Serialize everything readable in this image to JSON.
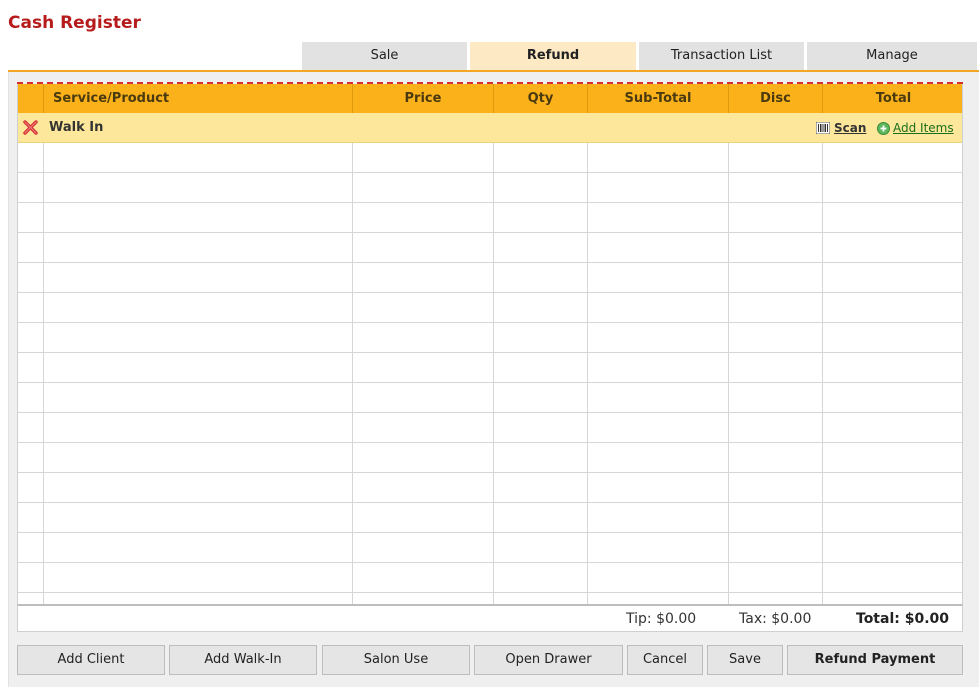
{
  "page": {
    "title": "Cash Register"
  },
  "tabs": [
    {
      "label": "Sale",
      "active": false
    },
    {
      "label": "Refund",
      "active": true
    },
    {
      "label": "Transaction List",
      "active": false
    },
    {
      "label": "Manage",
      "active": false
    }
  ],
  "table": {
    "columns": [
      "Service/Product",
      "Price",
      "Qty",
      "Sub-Total",
      "Disc",
      "Total"
    ],
    "client_row": {
      "label": "Walk In",
      "scan_label": "Scan",
      "add_items_label": "Add Items"
    },
    "rows": []
  },
  "totals": {
    "tip": "Tip: $0.00",
    "tax": "Tax: $0.00",
    "total": "Total: $0.00"
  },
  "buttons": {
    "add_client": "Add Client",
    "add_walk_in": "Add Walk-In",
    "salon_use": "Salon Use",
    "open_drawer": "Open Drawer",
    "cancel": "Cancel",
    "save": "Save",
    "refund_payment": "Refund Payment"
  },
  "colors": {
    "title": "#b71c1c",
    "header": "#fbb21a",
    "client_row": "#fde79b",
    "active_tab": "#fde9c4",
    "accent_line": "#f5a623",
    "remove_icon": "#d32f2f",
    "add_icon": "#4caf50"
  },
  "icons": {
    "remove": "close-x-icon",
    "scan": "barcode-icon",
    "add": "plus-circle-icon"
  }
}
